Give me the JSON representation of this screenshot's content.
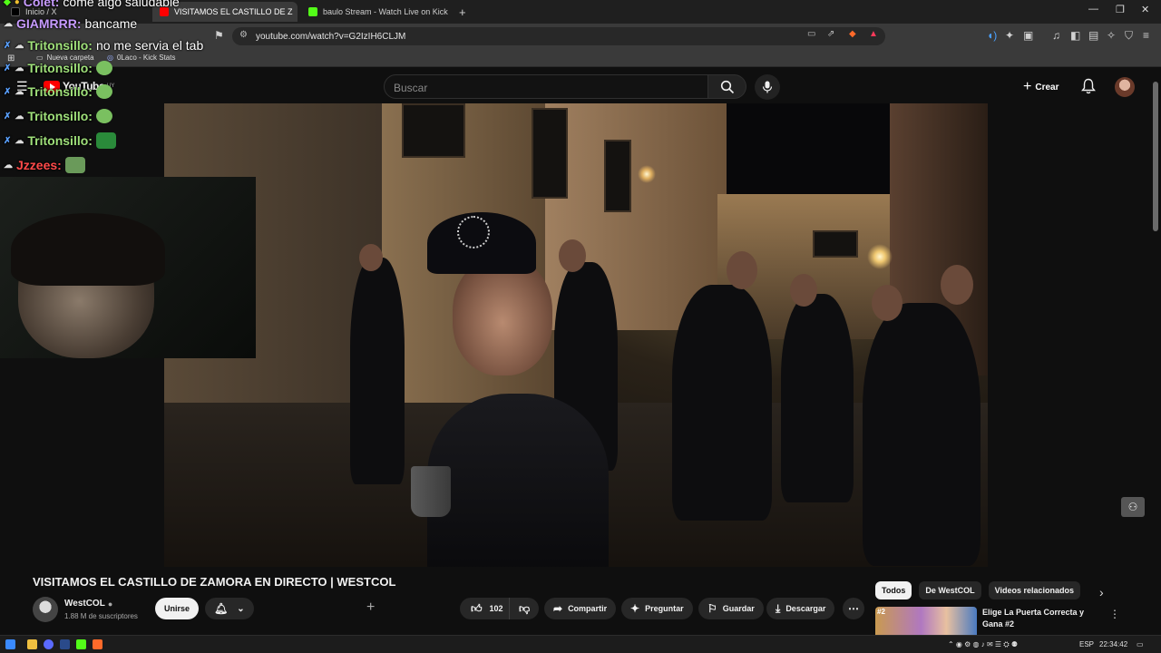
{
  "browser": {
    "tabs": [
      {
        "label": "Inicio / X",
        "favicon_color": "#000000"
      },
      {
        "label": "VISITAMOS EL CASTILLO DE Z",
        "favicon_color": "#ff0000"
      },
      {
        "label": "baulo Stream - Watch Live on Kick",
        "favicon_color": "#53fc18"
      }
    ],
    "new_tab_label": "+",
    "url": "youtube.com/watch?v=G2IzIH6CLJM",
    "bookmarks": [
      "Nueva carpeta",
      "0Laco - Kick Stats"
    ]
  },
  "youtube": {
    "logo_text": "YouTube",
    "logo_region": "UY",
    "search_placeholder": "Buscar",
    "create_label": "Crear",
    "video_title": "VISITAMOS EL CASTILLO DE ZAMORA EN DIRECTO | WESTCOL",
    "channel_name": "WestCOL",
    "subscribers": "1.88 M de suscriptores",
    "join_label": "Unirse",
    "likes": "102",
    "share_label": "Compartir",
    "ask_label": "Preguntar",
    "save_label": "Guardar",
    "download_label": "Descargar",
    "chips": [
      "Todos",
      "De WestCOL",
      "Videos relacionados"
    ],
    "recommended": {
      "title": "Elige La Puerta Correcta y Gana #2",
      "rank": "#2"
    }
  },
  "chat": [
    {
      "user": "Colet:",
      "message": "come algo saludable",
      "color": "#c79bff"
    },
    {
      "user": "GIAMRRR:",
      "message": "bancame",
      "color": "#c79bff"
    },
    {
      "user": "Tritonsillo:",
      "message": "no me servia el tab",
      "color": "#9fe07a"
    },
    {
      "user": "Tritonsillo:",
      "message": "",
      "color": "#9fe07a"
    },
    {
      "user": "Tritonsillo:",
      "message": "",
      "color": "#9fe07a"
    },
    {
      "user": "Tritonsillo:",
      "message": "",
      "color": "#9fe07a"
    },
    {
      "user": "Tritonsillo:",
      "message": "",
      "color": "#9fe07a"
    },
    {
      "user": "Jzzees:",
      "message": "",
      "color": "#ff4a4a"
    }
  ],
  "taskbar": {
    "language": "ESP",
    "time": "22:34:42"
  }
}
